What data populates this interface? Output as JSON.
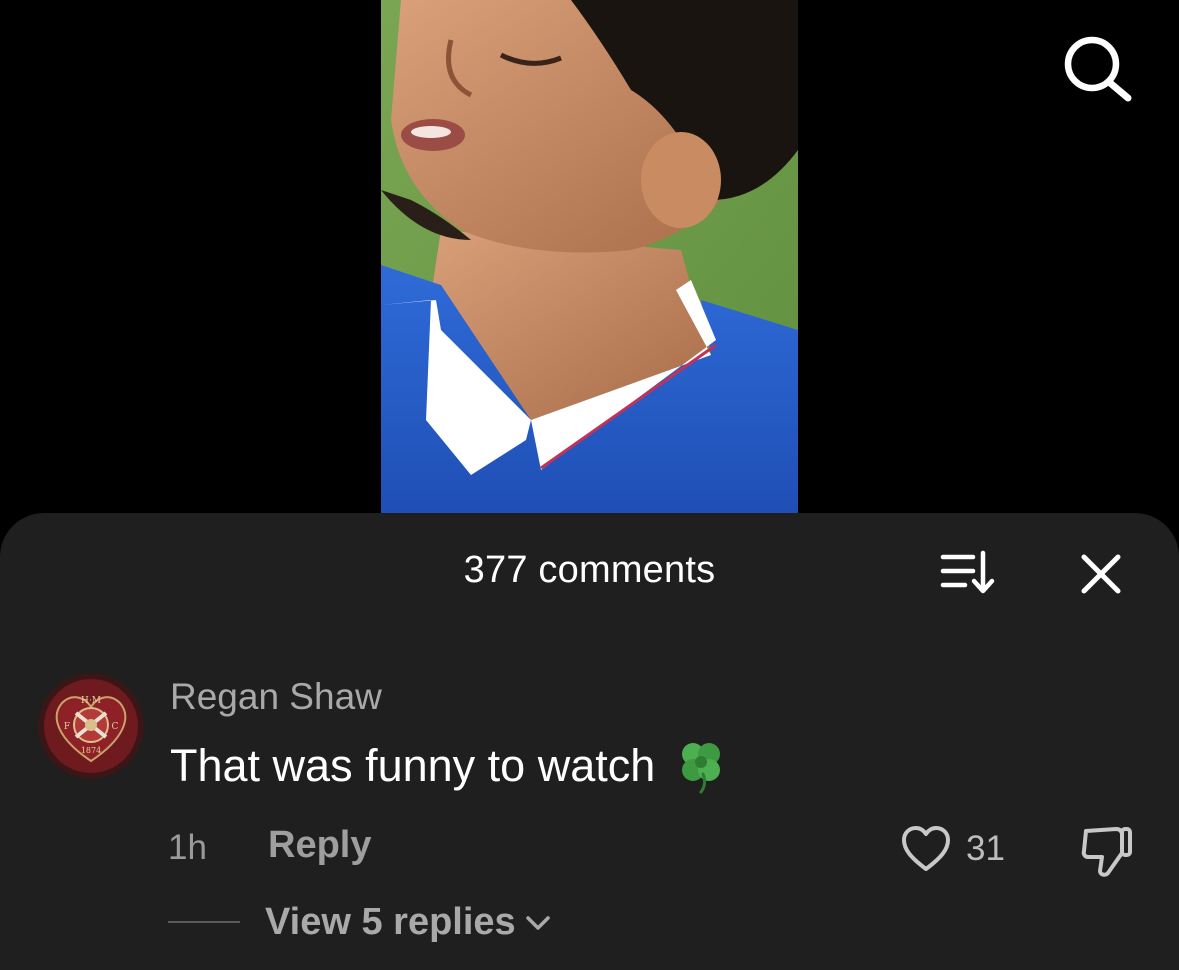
{
  "comments_sheet": {
    "title": "377 comments"
  },
  "comment": {
    "author": "Regan Shaw",
    "text": "That was funny to watch",
    "emoji": "shamrock-emoji",
    "time": "1h",
    "reply_label": "Reply",
    "like_count": "31",
    "view_replies_label": "View 5 replies"
  },
  "icons": {
    "search": "search-icon",
    "sort": "sort-icon",
    "close": "close-icon",
    "heart": "heart-icon",
    "dislike": "thumbs-down-icon",
    "chevron": "chevron-down-icon"
  },
  "avatar_crest": {
    "top_letters": "H·M",
    "left_letter": "F",
    "right_letter": "C",
    "year": "1874"
  },
  "colors": {
    "sheet_bg": "#1f1f1f",
    "screen_bg": "#000000",
    "muted_text": "#a9a9a9"
  }
}
